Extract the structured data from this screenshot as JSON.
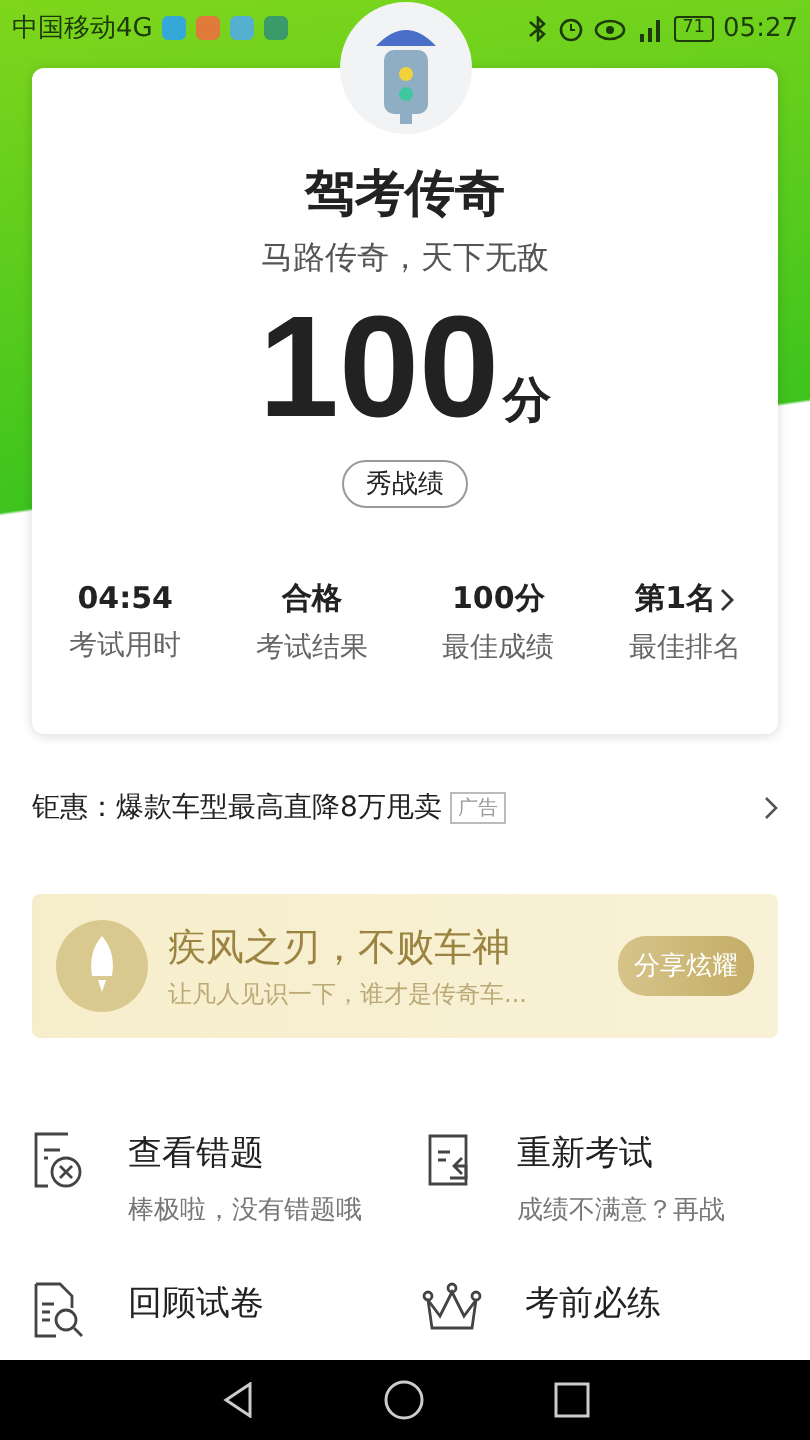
{
  "status_bar": {
    "carrier": "中国移动4G",
    "battery": "71",
    "time": "05:27"
  },
  "result_card": {
    "title": "驾考传奇",
    "subtitle": "马路传奇，天下无敌",
    "score": "100",
    "score_unit": "分",
    "share_button": "秀战绩",
    "stats": [
      {
        "value": "04:54",
        "label": "考试用时",
        "link": false
      },
      {
        "value": "合格",
        "label": "考试结果",
        "link": false
      },
      {
        "value": "100分",
        "label": "最佳成绩",
        "link": false
      },
      {
        "value": "第1名",
        "label": "最佳排名",
        "link": true
      }
    ]
  },
  "ad": {
    "text": "钜惠：爆款车型最高直降8万甩卖",
    "badge": "广告"
  },
  "banner": {
    "title": "疾风之刃，不败车神",
    "subtitle": "让凡人见识一下，谁才是传奇车...",
    "button": "分享炫耀"
  },
  "actions": [
    {
      "kind": "wrong",
      "title": "查看错题",
      "subtitle": "棒极啦，没有错题哦"
    },
    {
      "kind": "retry",
      "title": "重新考试",
      "subtitle": "成绩不满意？再战"
    },
    {
      "kind": "review",
      "title": "回顾试卷"
    },
    {
      "kind": "crown",
      "title": "考前必练"
    }
  ]
}
